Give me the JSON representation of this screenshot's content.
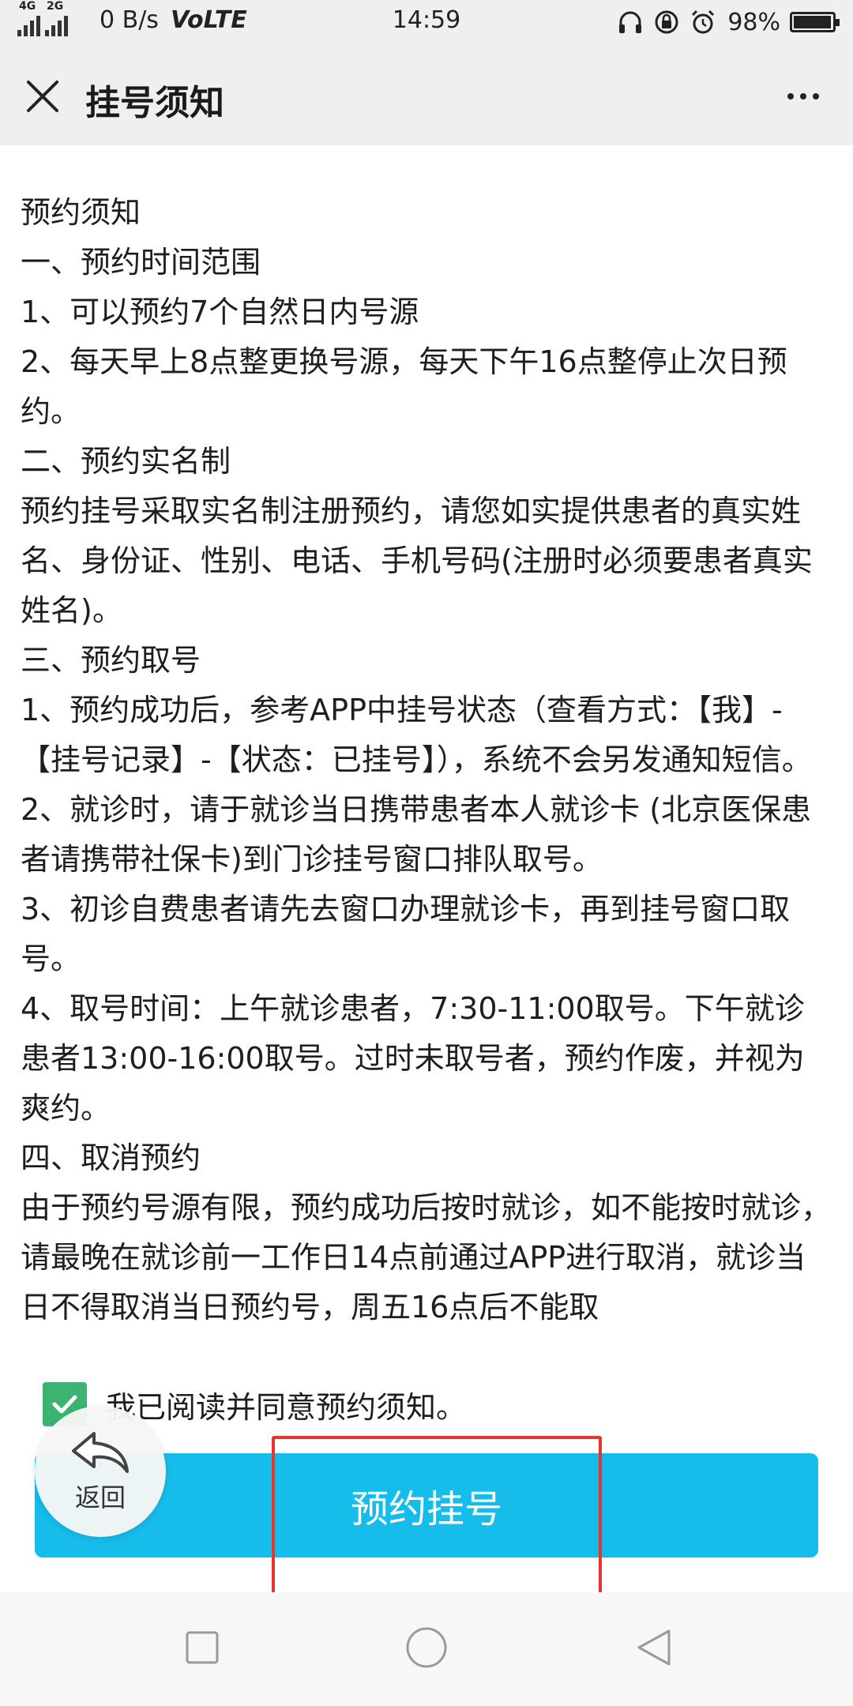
{
  "status_bar": {
    "signal1_label": "4G",
    "signal2_label": "2G",
    "net_speed": "0 B/s",
    "volte": "VoLTE",
    "time": "14:59",
    "battery_percent": "98%",
    "battery_level": 0.98,
    "icons": [
      "headphones-icon",
      "rotation-lock-icon",
      "alarm-icon",
      "battery-icon"
    ]
  },
  "header": {
    "title": "挂号须知",
    "close_icon": "close-icon",
    "more_icon": "more-icon"
  },
  "notice": {
    "lines": [
      "预约须知",
      "一、预约时间范围",
      "1、可以预约7个自然日内号源",
      "2、每天早上8点整更换号源，每天下午16点整停止次日预约。",
      "二、预约实名制",
      "预约挂号采取实名制注册预约，请您如实提供患者的真实姓名、身份证、性别、电话、手机号码(注册时必须要患者真实姓名)。",
      "三、预约取号",
      "1、预约成功后，参考APP中挂号状态（查看方式：【我】-【挂号记录】-【状态：已挂号】），系统不会另发通知短信。",
      "2、就诊时，请于就诊当日携带患者本人就诊卡 (北京医保患者请携带社保卡)到门诊挂号窗口排队取号。",
      "3、初诊自费患者请先去窗口办理就诊卡，再到挂号窗口取号。",
      "4、取号时间：上午就诊患者，7:30-11:00取号。下午就诊患者13:00-16:00取号。过时未取号者，预约作废，并视为爽约。",
      "四、取消预约",
      "由于预约号源有限，预约成功后按时就诊，如不能按时就诊，请最晚在就诊前一工作日14点前通过APP进行取消，就诊当日不得取消当日预约号，周五16点后不能取"
    ]
  },
  "agreement": {
    "checked": true,
    "label": "我已阅读并同意预约须知。"
  },
  "actions": {
    "book_label": "预约挂号",
    "back_label": "返回"
  },
  "colors": {
    "primary_button": "#16bcea",
    "checkbox": "#3cb371",
    "highlight": "#e8342e",
    "header_bg": "#efefef"
  },
  "nav": {
    "icons": [
      "recent-apps-icon",
      "home-icon",
      "back-icon"
    ]
  }
}
